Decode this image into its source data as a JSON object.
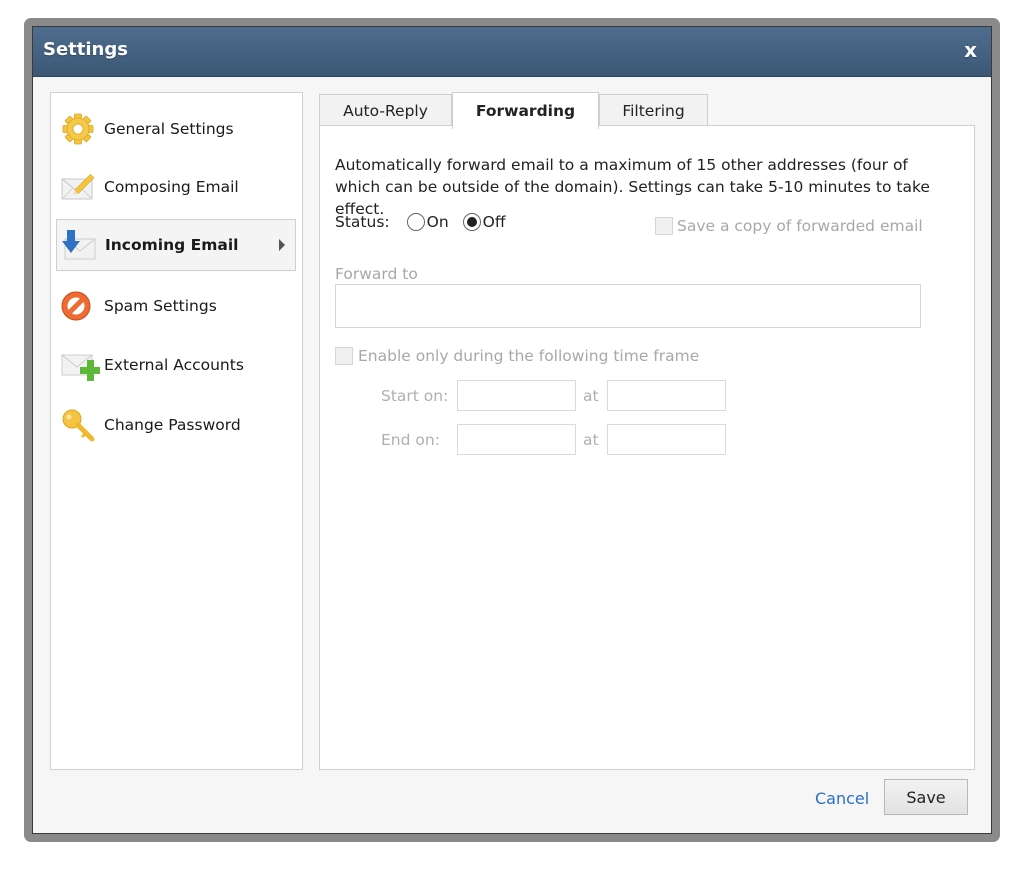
{
  "window": {
    "title": "Settings",
    "close_label": "x"
  },
  "sidebar": {
    "items": [
      {
        "label": "General Settings",
        "icon": "gear-icon"
      },
      {
        "label": "Composing Email",
        "icon": "envelope-pencil-icon"
      },
      {
        "label": "Incoming Email",
        "icon": "envelope-download-icon",
        "active": true
      },
      {
        "label": "Spam Settings",
        "icon": "prohibited-icon"
      },
      {
        "label": "External Accounts",
        "icon": "envelope-add-icon"
      },
      {
        "label": "Change Password",
        "icon": "key-icon"
      }
    ]
  },
  "tabs": [
    {
      "label": "Auto-Reply"
    },
    {
      "label": "Forwarding",
      "active": true
    },
    {
      "label": "Filtering"
    }
  ],
  "forwarding": {
    "description": "Automatically forward email to a maximum of 15 other addresses (four of which can be outside of the domain). Settings can take 5-10 minutes to take effect.",
    "status_label": "Status:",
    "status_options": [
      "On",
      "Off"
    ],
    "status_selected": "Off",
    "save_copy_label": "Save a copy of forwarded email",
    "save_copy_checked": false,
    "forward_to_label": "Forward to",
    "forward_to_value": "",
    "timeframe_label": "Enable only during the following time frame",
    "timeframe_checked": false,
    "start_on_label": "Start on:",
    "end_on_label": "End on:",
    "at_label": "at",
    "start_date": "",
    "start_time": "",
    "end_date": "",
    "end_time": ""
  },
  "footer": {
    "cancel_label": "Cancel",
    "save_label": "Save"
  },
  "colors": {
    "titlebar": "#3f5b7b",
    "link": "#2b6fc6",
    "disabled_text": "#a8a8a8"
  }
}
